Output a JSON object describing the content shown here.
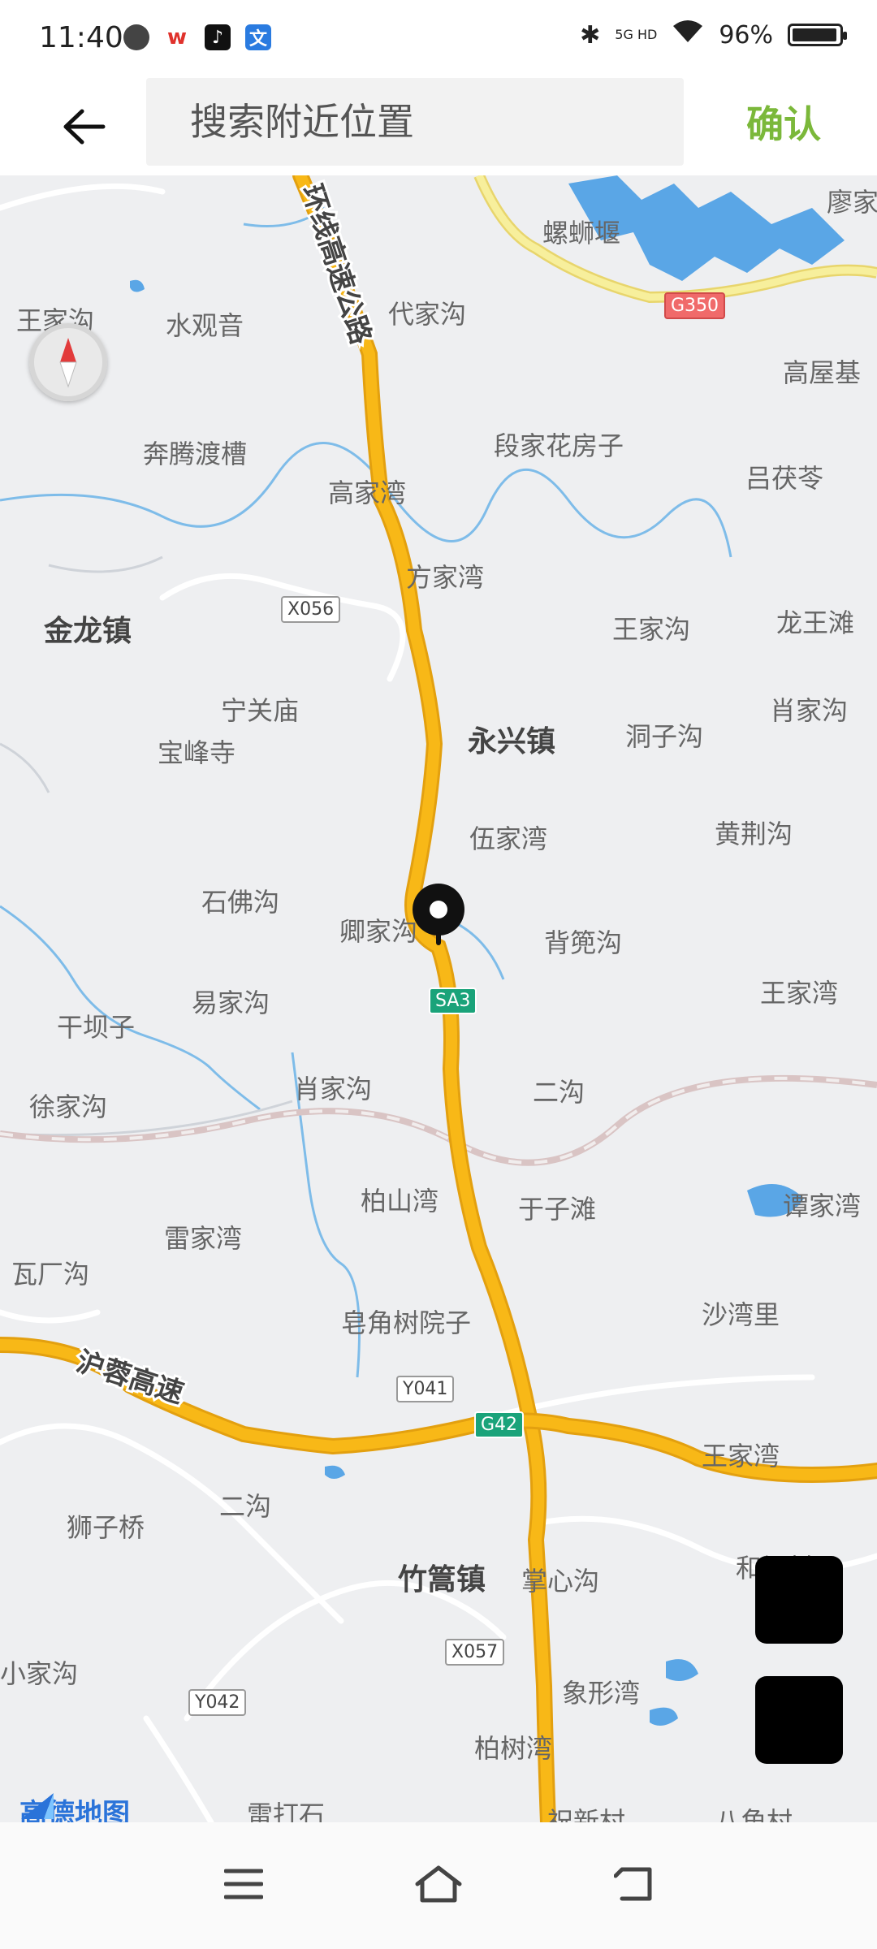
{
  "status_bar": {
    "time": "11:40",
    "network": "5G HD",
    "battery_text": "96%",
    "battery_level": 0.96,
    "icons": [
      "chat-icon",
      "wps-icon",
      "tiktok-icon",
      "translate-icon",
      "bluetooth-icon",
      "signal-icon",
      "wifi-icon",
      "battery-icon"
    ]
  },
  "header": {
    "search_placeholder": "搜索附近位置",
    "confirm_label": "确认"
  },
  "map": {
    "highway_name": "绕城环线高速公路",
    "highway_name_visible": "环线高速公路",
    "expressway_name": "沪蓉高速",
    "place_labels": [
      {
        "id": "l1",
        "text": "螺蛳堰"
      },
      {
        "id": "l2",
        "text": "廖家"
      },
      {
        "id": "l3",
        "text": "王家沟"
      },
      {
        "id": "l4",
        "text": "水观音"
      },
      {
        "id": "l5",
        "text": "代家沟"
      },
      {
        "id": "l6",
        "text": "高屋基"
      },
      {
        "id": "l7",
        "text": "奔腾渡槽"
      },
      {
        "id": "l8",
        "text": "段家花房子"
      },
      {
        "id": "l9",
        "text": "高家湾"
      },
      {
        "id": "l10",
        "text": "吕茯苓"
      },
      {
        "id": "l11",
        "text": "方家湾"
      },
      {
        "id": "l12",
        "text": "王家沟"
      },
      {
        "id": "l13",
        "text": "龙王滩"
      },
      {
        "id": "l14",
        "text": "宁关庙"
      },
      {
        "id": "l15",
        "text": "肖家沟"
      },
      {
        "id": "l16",
        "text": "宝峰寺"
      },
      {
        "id": "l17",
        "text": "洞子沟"
      },
      {
        "id": "l18",
        "text": "伍家湾"
      },
      {
        "id": "l19",
        "text": "黄荆沟"
      },
      {
        "id": "l20",
        "text": "石佛沟"
      },
      {
        "id": "l21",
        "text": "卿家沟"
      },
      {
        "id": "l22",
        "text": "背篼沟"
      },
      {
        "id": "l23",
        "text": "易家沟"
      },
      {
        "id": "l24",
        "text": "王家湾"
      },
      {
        "id": "l25",
        "text": "干坝子"
      },
      {
        "id": "l26",
        "text": "肖家沟"
      },
      {
        "id": "l27",
        "text": "二沟"
      },
      {
        "id": "l28",
        "text": "徐家沟"
      },
      {
        "id": "l29",
        "text": "柏山湾"
      },
      {
        "id": "l30",
        "text": "于子滩"
      },
      {
        "id": "l31",
        "text": "谭家湾"
      },
      {
        "id": "l32",
        "text": "雷家湾"
      },
      {
        "id": "l33",
        "text": "瓦厂沟"
      },
      {
        "id": "l34",
        "text": "沙湾里"
      },
      {
        "id": "l35",
        "text": "皂角树院子"
      },
      {
        "id": "l36",
        "text": "王家湾"
      },
      {
        "id": "l37",
        "text": "二沟"
      },
      {
        "id": "l38",
        "text": "狮子桥"
      },
      {
        "id": "l39",
        "text": "掌心沟"
      },
      {
        "id": "l40",
        "text": "和坪村"
      },
      {
        "id": "l41",
        "text": "小家沟"
      },
      {
        "id": "l42",
        "text": "象形湾"
      },
      {
        "id": "l43",
        "text": "柏树湾"
      },
      {
        "id": "l44",
        "text": "雷打石"
      },
      {
        "id": "l45",
        "text": "祝新村"
      },
      {
        "id": "l46",
        "text": "八角村"
      }
    ],
    "town_labels": [
      {
        "id": "t1",
        "text": "金龙镇"
      },
      {
        "id": "t2",
        "text": "永兴镇"
      },
      {
        "id": "t3",
        "text": "竹篙镇"
      }
    ],
    "road_shields": [
      {
        "id": "s1",
        "text": "G350",
        "kind": "g"
      },
      {
        "id": "s2",
        "text": "X056",
        "kind": "x"
      },
      {
        "id": "s3",
        "text": "SA3",
        "kind": "green"
      },
      {
        "id": "s4",
        "text": "Y041",
        "kind": "x"
      },
      {
        "id": "s5",
        "text": "G42",
        "kind": "green"
      },
      {
        "id": "s6",
        "text": "X057",
        "kind": "x"
      },
      {
        "id": "s7",
        "text": "Y042",
        "kind": "x"
      }
    ],
    "logo_text": "高德地图"
  },
  "colors": {
    "confirm": "#7bb83a",
    "highway": "#f8b817",
    "national_road": "#f3e58a",
    "water": "#6fb3e8",
    "map_background": "#eeeff1"
  }
}
